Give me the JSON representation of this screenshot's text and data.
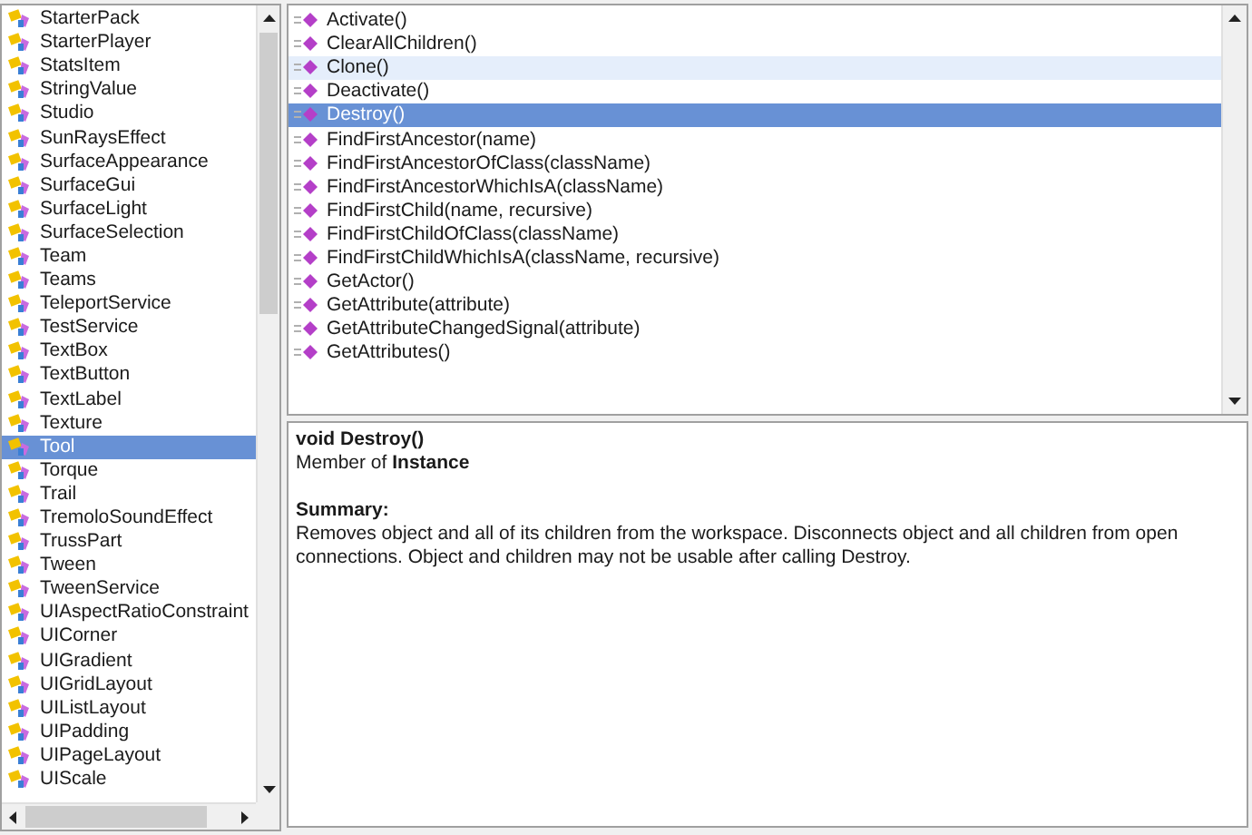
{
  "classes": [
    {
      "name": "StarterPack",
      "selected": false
    },
    {
      "name": "StarterPlayer",
      "selected": false
    },
    {
      "name": "StatsItem",
      "selected": false
    },
    {
      "name": "StringValue",
      "selected": false
    },
    {
      "name": "Studio",
      "selected": false
    },
    {
      "name": "SunRaysEffect",
      "selected": false
    },
    {
      "name": "SurfaceAppearance",
      "selected": false
    },
    {
      "name": "SurfaceGui",
      "selected": false
    },
    {
      "name": "SurfaceLight",
      "selected": false
    },
    {
      "name": "SurfaceSelection",
      "selected": false
    },
    {
      "name": "Team",
      "selected": false
    },
    {
      "name": "Teams",
      "selected": false
    },
    {
      "name": "TeleportService",
      "selected": false
    },
    {
      "name": "TestService",
      "selected": false
    },
    {
      "name": "TextBox",
      "selected": false
    },
    {
      "name": "TextButton",
      "selected": false
    },
    {
      "name": "TextLabel",
      "selected": false
    },
    {
      "name": "Texture",
      "selected": false
    },
    {
      "name": "Tool",
      "selected": true
    },
    {
      "name": "Torque",
      "selected": false
    },
    {
      "name": "Trail",
      "selected": false
    },
    {
      "name": "TremoloSoundEffect",
      "selected": false
    },
    {
      "name": "TrussPart",
      "selected": false
    },
    {
      "name": "Tween",
      "selected": false
    },
    {
      "name": "TweenService",
      "selected": false
    },
    {
      "name": "UIAspectRatioConstraint",
      "selected": false
    },
    {
      "name": "UICorner",
      "selected": false
    },
    {
      "name": "UIGradient",
      "selected": false
    },
    {
      "name": "UIGridLayout",
      "selected": false
    },
    {
      "name": "UIListLayout",
      "selected": false
    },
    {
      "name": "UIPadding",
      "selected": false
    },
    {
      "name": "UIPageLayout",
      "selected": false
    },
    {
      "name": "UIScale",
      "selected": false
    }
  ],
  "members": [
    {
      "name": "Activate()",
      "selected": false,
      "hovered": false
    },
    {
      "name": "ClearAllChildren()",
      "selected": false,
      "hovered": false
    },
    {
      "name": "Clone()",
      "selected": false,
      "hovered": true
    },
    {
      "name": "Deactivate()",
      "selected": false,
      "hovered": false
    },
    {
      "name": "Destroy()",
      "selected": true,
      "hovered": false
    },
    {
      "name": "FindFirstAncestor(name)",
      "selected": false,
      "hovered": false
    },
    {
      "name": "FindFirstAncestorOfClass(className)",
      "selected": false,
      "hovered": false
    },
    {
      "name": "FindFirstAncestorWhichIsA(className)",
      "selected": false,
      "hovered": false
    },
    {
      "name": "FindFirstChild(name, recursive)",
      "selected": false,
      "hovered": false
    },
    {
      "name": "FindFirstChildOfClass(className)",
      "selected": false,
      "hovered": false
    },
    {
      "name": "FindFirstChildWhichIsA(className, recursive)",
      "selected": false,
      "hovered": false
    },
    {
      "name": "GetActor()",
      "selected": false,
      "hovered": false
    },
    {
      "name": "GetAttribute(attribute)",
      "selected": false,
      "hovered": false
    },
    {
      "name": "GetAttributeChangedSignal(attribute)",
      "selected": false,
      "hovered": false
    },
    {
      "name": "GetAttributes()",
      "selected": false,
      "hovered": false
    }
  ],
  "details": {
    "signature": "void Destroy()",
    "member_of": "Member of **Instance**",
    "summary_heading": "Summary:",
    "summary": "Removes object and all of its children from the workspace. Disconnects object and all children from open connections. Object and children may not be usable after calling Destroy."
  }
}
